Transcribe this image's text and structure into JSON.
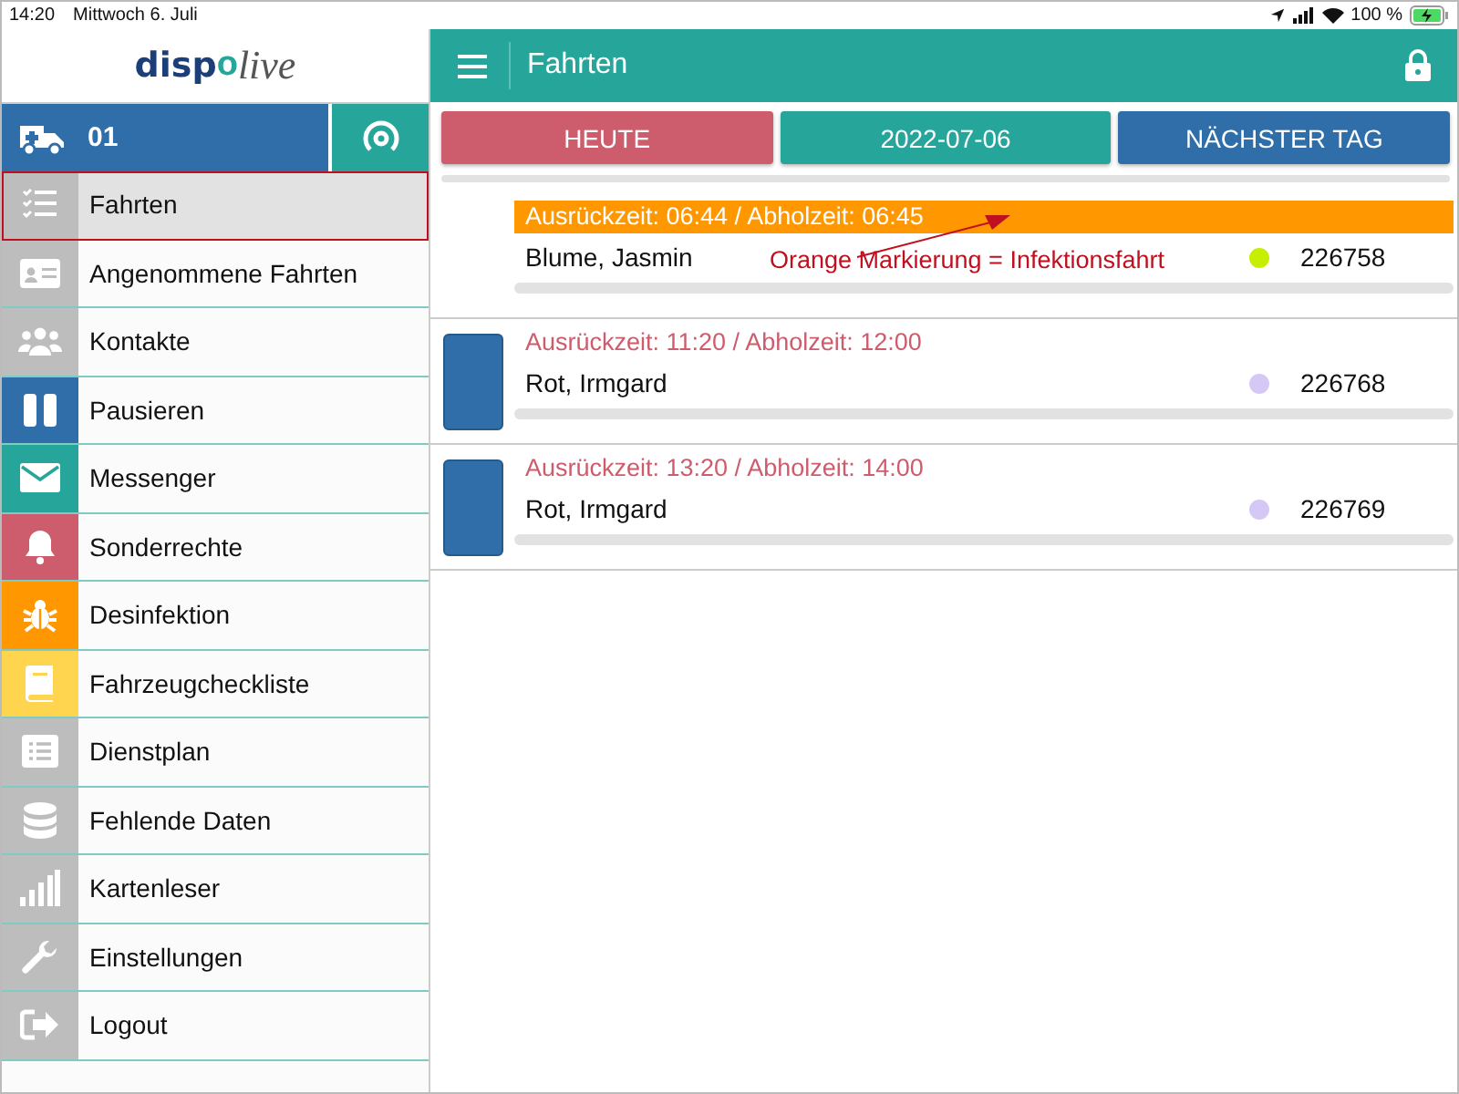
{
  "status_bar": {
    "time": "14:20",
    "date": "Mittwoch 6. Juli",
    "battery": "100 %"
  },
  "sidebar": {
    "logo": {
      "first": "disp",
      "mark": "o",
      "second": "live"
    },
    "vehicle": {
      "label": "01"
    },
    "items": [
      {
        "label": "Fahrten",
        "kind": "checklist",
        "color": "#bdbdbd",
        "selected": true
      },
      {
        "label": "Angenommene Fahrten",
        "kind": "idcard",
        "color": "#bdbdbd",
        "selected": false
      },
      {
        "label": "Kontakte",
        "kind": "people",
        "color": "#bdbdbd",
        "selected": false
      },
      {
        "label": "Pausieren",
        "kind": "pause",
        "color": "#2f6ea8",
        "selected": false
      },
      {
        "label": "Messenger",
        "kind": "mail",
        "color": "#26a69a",
        "selected": false
      },
      {
        "label": "Sonderrechte",
        "kind": "bell",
        "color": "#cd5c6c",
        "selected": false
      },
      {
        "label": "Desinfektion",
        "kind": "bug",
        "color": "#ff9800",
        "selected": false
      },
      {
        "label": "Fahrzeugcheckliste",
        "kind": "book",
        "color": "#ffd54f",
        "selected": false
      },
      {
        "label": "Dienstplan",
        "kind": "list",
        "color": "#bdbdbd",
        "selected": false
      },
      {
        "label": "Fehlende Daten",
        "kind": "database",
        "color": "#bdbdbd",
        "selected": false
      },
      {
        "label": "Kartenleser",
        "kind": "signal",
        "color": "#bdbdbd",
        "selected": false
      },
      {
        "label": "Einstellungen",
        "kind": "wrench",
        "color": "#bdbdbd",
        "selected": false
      },
      {
        "label": "Logout",
        "kind": "logout",
        "color": "#bdbdbd",
        "selected": false
      }
    ]
  },
  "header": {
    "title": "Fahrten"
  },
  "date_buttons": [
    {
      "label": "HEUTE",
      "kind": "today"
    },
    {
      "label": "2022-07-06",
      "kind": "date"
    },
    {
      "label": "NÄCHSTER TAG",
      "kind": "next"
    }
  ],
  "trips": [
    {
      "times": "Ausrückzeit: 06:44 / Abholzeit: 06:45",
      "infection": true,
      "marker": false,
      "name": "Blume, Jasmin",
      "color": "#c6ef00",
      "number": "226758",
      "annotation": "Orange Markierung = Infektionsfahrt"
    },
    {
      "times": "Ausrückzeit: 11:20 / Abholzeit: 12:00",
      "infection": false,
      "marker": true,
      "name": "Rot, Irmgard",
      "color": "#d5c8f5",
      "number": "226768"
    },
    {
      "times": "Ausrückzeit: 13:20 / Abholzeit: 14:00",
      "infection": false,
      "marker": true,
      "name": "Rot, Irmgard",
      "color": "#d5c8f5",
      "number": "226769"
    }
  ]
}
